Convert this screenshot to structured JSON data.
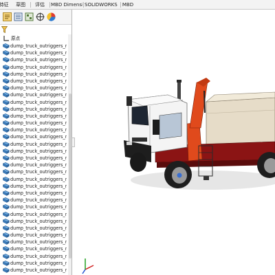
{
  "ribbon": {
    "tabs": [
      {
        "label": "特征",
        "active": true
      },
      {
        "label": "草图",
        "active": false
      },
      {
        "label": "评估",
        "active": false
      },
      {
        "label": "MBD Dimensions",
        "active": false
      },
      {
        "label": "SOLIDWORKS 插件",
        "active": false
      },
      {
        "label": "MBD",
        "active": false
      }
    ]
  },
  "feature_tree": {
    "toolbar_icons": [
      "feature-manager-icon",
      "property-manager-icon",
      "configuration-manager-icon",
      "dimxpert-icon",
      "display-manager-icon"
    ],
    "origin_label": "原点",
    "component_label": "dump_truck_outriggers_not_ex",
    "colors": {
      "component_icon": "#3c7fc0",
      "origin_icon": "#333333"
    }
  },
  "viewport": {
    "colors": {
      "cab": "#f4f4f4",
      "boom": "#e04a1c",
      "chassis": "#8b1414",
      "dump_body": "#e6dcc8",
      "tire": "#1e1e1e"
    }
  }
}
